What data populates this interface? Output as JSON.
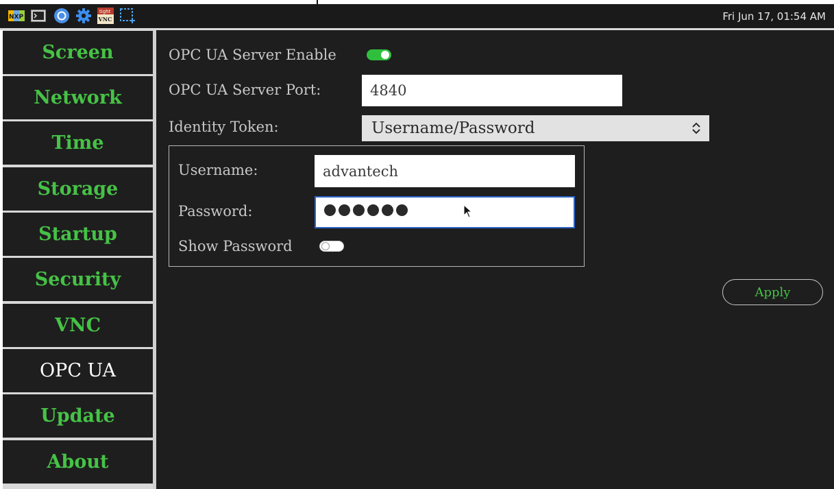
{
  "top_panel": {
    "clock": "Fri Jun 17, 01:54 AM",
    "tray_icons": [
      "nxp-logo-icon",
      "terminal-icon",
      "chromium-icon",
      "settings-gear-icon",
      "tightvnc-icon",
      "screenshot-region-icon"
    ],
    "tray_labels": {
      "nxp": "NXP",
      "vnc_top": "tight",
      "vnc_bottom": "VNC"
    }
  },
  "sidebar": {
    "items": [
      {
        "label": "Screen"
      },
      {
        "label": "Network"
      },
      {
        "label": "Time"
      },
      {
        "label": "Storage"
      },
      {
        "label": "Startup"
      },
      {
        "label": "Security"
      },
      {
        "label": "VNC"
      },
      {
        "label": "OPC UA"
      },
      {
        "label": "Update"
      },
      {
        "label": "About"
      }
    ],
    "active": "OPC UA"
  },
  "opcua": {
    "enable_label": "OPC UA Server Enable",
    "enable_state": "on",
    "port_label": "OPC UA Server Port:",
    "port_value": "4840",
    "identity_label": "Identity Token:",
    "identity_value": "Username/Password",
    "auth": {
      "username_label": "Username:",
      "username_value": "advantech",
      "password_label": "Password:",
      "password_masked_length": 6,
      "show_password_label": "Show Password",
      "show_password_state": "off"
    },
    "apply_label": "Apply"
  },
  "colors": {
    "accent_green": "#46c246",
    "panel_bg": "#1e1e1e",
    "topbar_bg": "#1a1a1a",
    "focus_blue": "#2c64c8",
    "toggle_on": "#2fbf3c"
  }
}
